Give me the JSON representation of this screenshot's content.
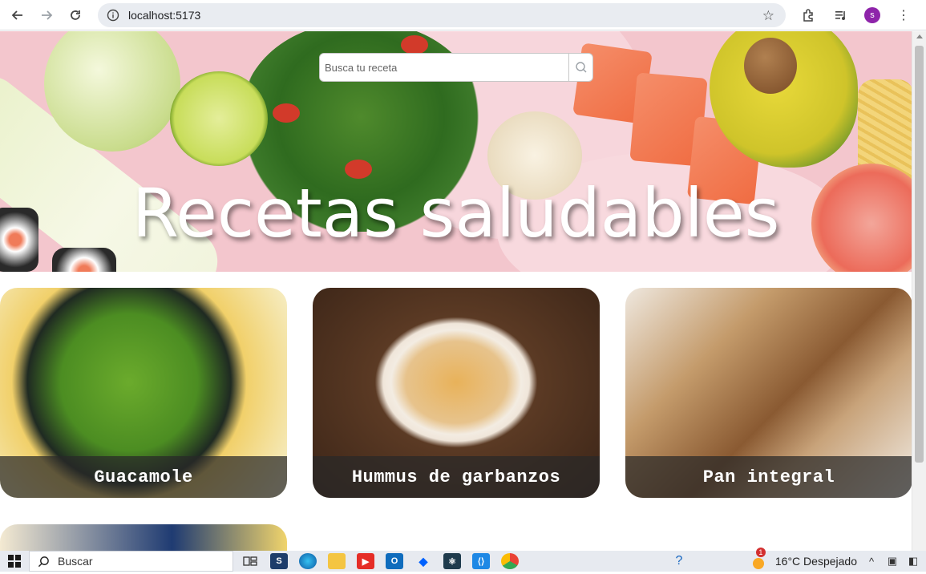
{
  "browser": {
    "url": "localhost:5173",
    "profile_initial": "s"
  },
  "page": {
    "search": {
      "placeholder": "Busca tu receta",
      "value": ""
    },
    "hero_title": "Recetas saludables",
    "cards": [
      {
        "label": "Guacamole"
      },
      {
        "label": "Hummus de garbanzos"
      },
      {
        "label": "Pan integral"
      }
    ]
  },
  "taskbar": {
    "search_label": "Buscar",
    "apps": [
      "task-view",
      "terminal",
      "edge",
      "file-explorer",
      "youtube",
      "outlook",
      "dropbox",
      "app-blue",
      "vscode",
      "chrome"
    ],
    "weather": {
      "badge": "1",
      "text": "16°C  Despejado"
    }
  },
  "colors": {
    "hero_bg": "#f3c6cd",
    "card_label_bg": "#282828",
    "profile": "#8e24aa"
  }
}
